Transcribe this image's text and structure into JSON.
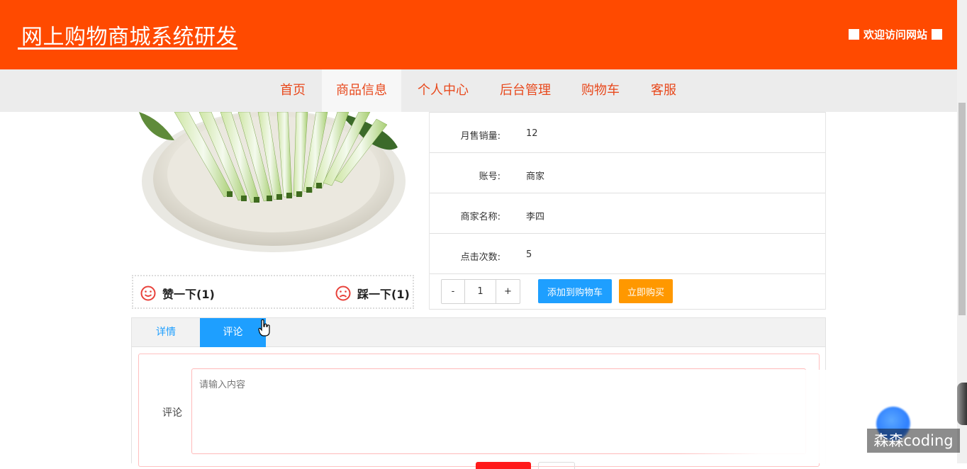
{
  "header": {
    "site_title": "网上购物商城系统研发",
    "welcome_text": "欢迎访问网站"
  },
  "nav": {
    "items": [
      {
        "label": "首页"
      },
      {
        "label": "商品信息",
        "active": true
      },
      {
        "label": "个人中心"
      },
      {
        "label": "后台管理"
      },
      {
        "label": "购物车"
      },
      {
        "label": "客服"
      }
    ]
  },
  "product": {
    "vote": {
      "like_label": "赞一下(1)",
      "dislike_label": "踩一下(1)"
    },
    "info": [
      {
        "label": "月售销量:",
        "value": "12"
      },
      {
        "label": "账号:",
        "value": "商家"
      },
      {
        "label": "商家名称:",
        "value": "李四"
      },
      {
        "label": "点击次数:",
        "value": "5"
      }
    ],
    "quantity": {
      "minus": "-",
      "value": "1",
      "plus": "+"
    },
    "add_to_cart_label": "添加到购物车",
    "buy_now_label": "立即购买"
  },
  "tabs": {
    "items": [
      {
        "label": "详情"
      },
      {
        "label": "评论",
        "active": true
      }
    ]
  },
  "comment_form": {
    "label": "评论",
    "placeholder": "请输入内容"
  },
  "watermark": "森森coding",
  "colors": {
    "header_bg": "#ff4a00",
    "nav_text": "#e8491d",
    "primary_blue": "#1e9fff",
    "buy_orange": "#ff9800",
    "face_red": "#e8413a"
  }
}
